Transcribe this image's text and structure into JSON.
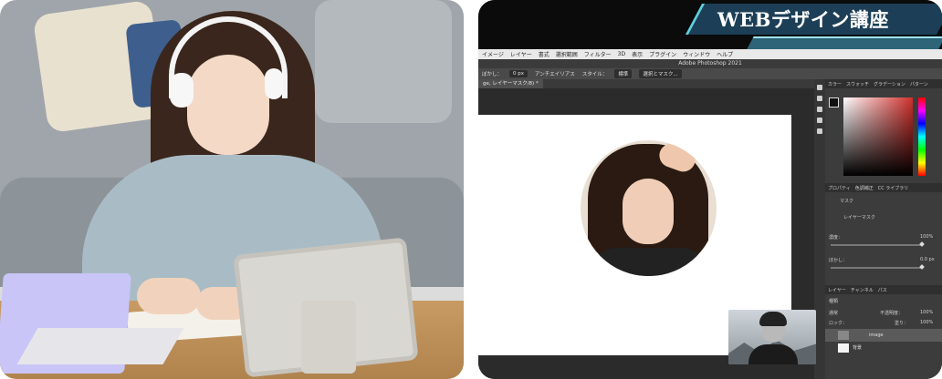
{
  "banner": {
    "title": "WEBデザイン講座"
  },
  "photoshop": {
    "app_title": "Adobe Photoshop 2021",
    "menu": [
      "レイヤー",
      "書式",
      "選択範囲",
      "フィルター",
      "3D",
      "表示",
      "プラグイン",
      "ウィンドウ",
      "ヘルプ"
    ],
    "menu_first": "イメージ",
    "options": {
      "blur_label": "ぼかし：",
      "blur_value": "0 px",
      "antialias": "アンチエイリアス",
      "style_label": "スタイル：",
      "style_value": "標準",
      "select_mask": "選択とマスク..."
    },
    "document_tab": "ge, レイヤーマスク/8) *",
    "color_panel_tabs": [
      "カラー",
      "スウォッチ",
      "グラデーション",
      "パターン"
    ],
    "properties_tabs": [
      "プロパティ",
      "色調補正",
      "CC ライブラリ"
    ],
    "properties": {
      "mask_label": "マスク",
      "layer_mask": "レイヤーマスク",
      "density_label": "濃度：",
      "density_value": "100%",
      "feather_label": "ぼかし：",
      "feather_value": "0.0 px"
    },
    "layers_tabs": [
      "レイヤー",
      "チャンネル",
      "パス"
    ],
    "layers": {
      "kind": "種類",
      "blend": "通常",
      "opacity_label": "不透明度：",
      "opacity_value": "100%",
      "lock_label": "ロック：",
      "fill_label": "塗り：",
      "fill_value": "100%",
      "items": [
        {
          "name": "image"
        },
        {
          "name": "背景"
        }
      ]
    }
  }
}
